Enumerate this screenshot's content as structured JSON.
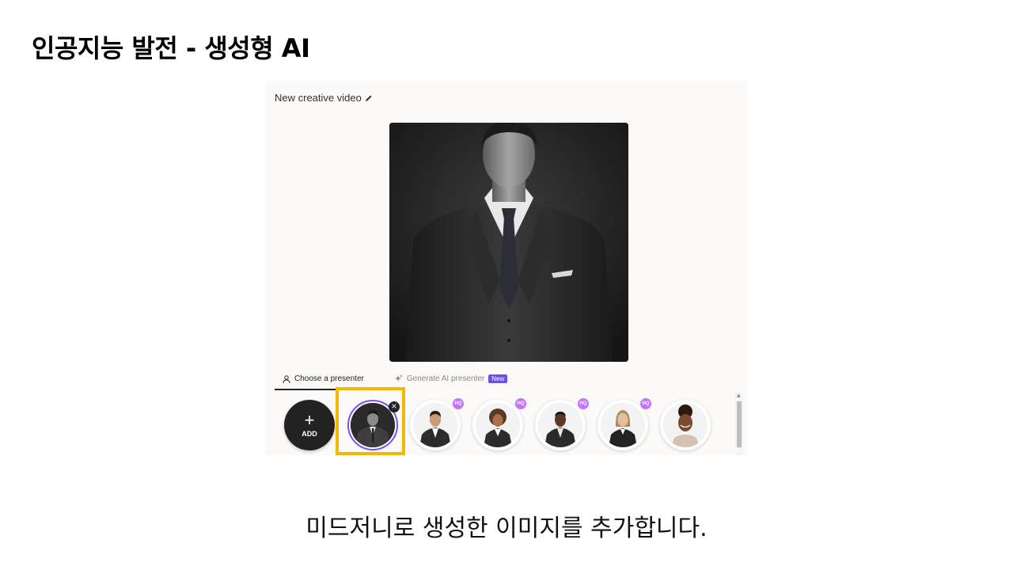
{
  "slide": {
    "title": "인공지능 발전 - 생성형 AI",
    "caption": "미드저니로 생성한 이미지를 추가합니다."
  },
  "app": {
    "video_title": "New creative video",
    "tabs": [
      {
        "label": "Choose a presenter",
        "icon": "user-icon",
        "active": true
      },
      {
        "label": "Generate AI presenter",
        "icon": "sparkle-icon",
        "badge": "New",
        "active": false
      }
    ],
    "add_button": {
      "icon": "+",
      "label": "ADD"
    },
    "presenters": [
      {
        "name": "selected-presenter",
        "selected": true,
        "hq": false
      },
      {
        "name": "presenter",
        "hq": true,
        "hq_label": "HQ"
      },
      {
        "name": "presenter",
        "hq": true,
        "hq_label": "HQ"
      },
      {
        "name": "presenter",
        "hq": true,
        "hq_label": "HQ"
      },
      {
        "name": "presenter",
        "hq": true,
        "hq_label": "HQ"
      },
      {
        "name": "presenter",
        "hq": false
      }
    ],
    "colors": {
      "accent": "#6d4aff",
      "hq": "#c472ff",
      "highlight": "#f5b800"
    }
  }
}
